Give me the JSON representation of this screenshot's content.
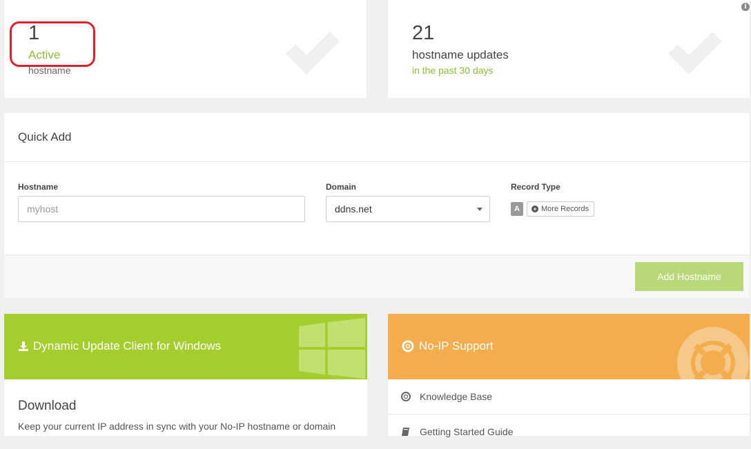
{
  "stats": {
    "hostnames": {
      "count": "1",
      "status": "Active",
      "label": "hostname"
    },
    "updates": {
      "count": "21",
      "label": "hostname updates",
      "period": "in the past 30 days"
    }
  },
  "quick_add": {
    "title": "Quick Add",
    "hostname": {
      "label": "Hostname",
      "placeholder": "myhost"
    },
    "domain": {
      "label": "Domain",
      "value": "ddns.net"
    },
    "record_type": {
      "label": "Record Type",
      "selected": "A",
      "more_label": "More Records"
    },
    "submit_label": "Add Hostname"
  },
  "download_card": {
    "header": "Dynamic Update Client for Windows",
    "title": "Download",
    "description": "Keep your current IP address in sync with your No-IP hostname or domain"
  },
  "support_card": {
    "header": "No-IP Support",
    "items": [
      {
        "label": "Knowledge Base",
        "icon": "lifebuoy-icon"
      },
      {
        "label": "Getting Started Guide",
        "icon": "book-icon"
      }
    ]
  },
  "colors": {
    "green_accent": "#8bbf35",
    "download_header": "#a3ce2e",
    "support_header": "#f3ad4c",
    "add_button": "#b9d87a",
    "highlight_ring": "#e0202a"
  }
}
